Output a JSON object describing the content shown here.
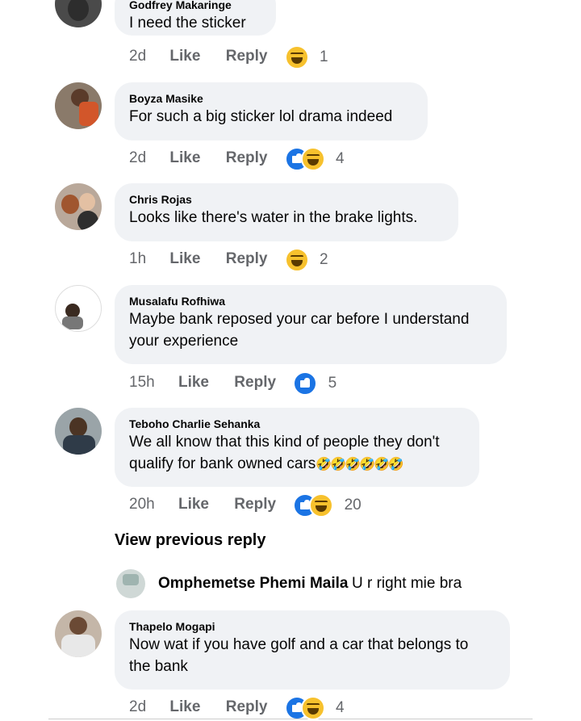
{
  "comments": [
    {
      "name": "Godfrey Makaringe",
      "text": "I need the sticker",
      "time": "2d",
      "like": "Like",
      "reply": "Reply",
      "reactions": [
        "haha"
      ],
      "count": "1"
    },
    {
      "name": "Boyza Masike",
      "text": "For such a big sticker lol drama indeed",
      "time": "2d",
      "like": "Like",
      "reply": "Reply",
      "reactions": [
        "like",
        "haha"
      ],
      "count": "4"
    },
    {
      "name": "Chris Rojas",
      "text": "Looks like there's water in the brake lights.",
      "time": "1h",
      "like": "Like",
      "reply": "Reply",
      "reactions": [
        "haha"
      ],
      "count": "2"
    },
    {
      "name": "Musalafu Rofhiwa",
      "text_line1": "Maybe bank reposed your car before I understand",
      "text_line2": "your experience",
      "time": "15h",
      "like": "Like",
      "reply": "Reply",
      "reactions": [
        "like"
      ],
      "count": "5"
    },
    {
      "name": "Teboho Charlie Sehanka",
      "text_line1": "We all know that this kind of people they don't",
      "text_line2": "qualify for bank owned cars",
      "emoji": "🤣🤣🤣🤣🤣🤣",
      "time": "20h",
      "like": "Like",
      "reply": "Reply",
      "reactions": [
        "like",
        "haha"
      ],
      "count": "20"
    },
    {
      "name": "Thapelo Mogapi",
      "text_line1": "Now wat if you have golf and a car that belongs to",
      "text_line2": "the bank",
      "time": "2d",
      "like": "Like",
      "reply": "Reply",
      "reactions": [
        "like",
        "haha"
      ],
      "count": "4"
    }
  ],
  "view_previous": "View previous reply",
  "reply": {
    "name": "Omphemetse Phemi Maila",
    "text": "U r right mie bra"
  },
  "colors": {
    "bubble": "#f0f2f5",
    "meta": "#65676b",
    "like_blue": "#1b74e4",
    "haha_yellow": "#f7c12d"
  }
}
